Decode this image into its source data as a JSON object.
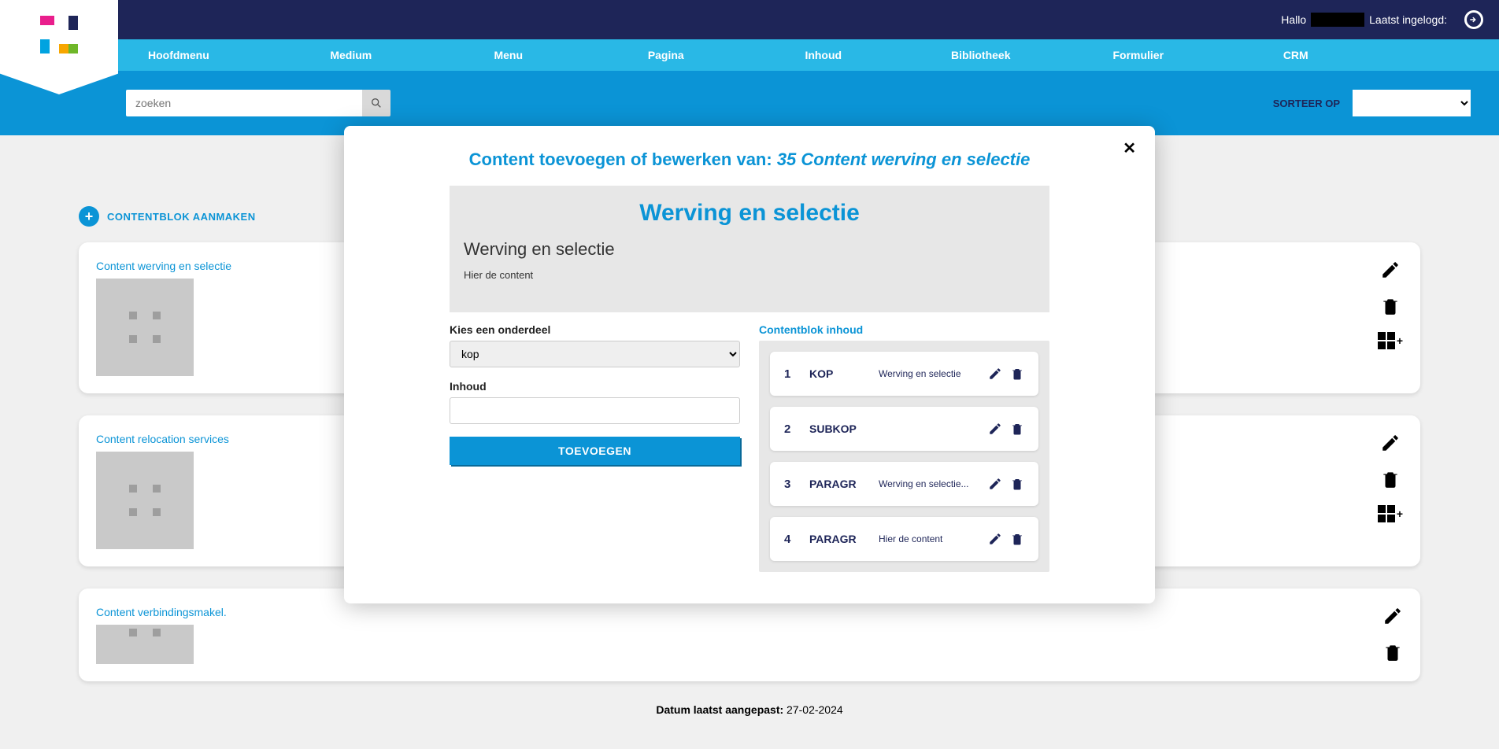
{
  "header": {
    "greeting_prefix": "Hallo",
    "last_login_label": "Laatst ingelogd:"
  },
  "nav": {
    "items": [
      "Hoofdmenu",
      "Medium",
      "Menu",
      "Pagina",
      "Inhoud",
      "Bibliotheek",
      "Formulier",
      "CRM"
    ]
  },
  "search": {
    "placeholder": "zoeken"
  },
  "sort": {
    "label": "SORTEER OP"
  },
  "create_block_label": "CONTENTBLOK AANMAKEN",
  "cards": [
    {
      "title": "Content werving en selectie"
    },
    {
      "title": "Content relocation services"
    },
    {
      "title": "Content verbindingsmakel."
    }
  ],
  "date": {
    "label": "Datum laatst aangepast:",
    "value": "27-02-2024"
  },
  "modal": {
    "title_prefix": "Content toevoegen of bewerken van: ",
    "title_italic": "35 Content werving en selectie",
    "preview": {
      "heading": "Werving en selectie",
      "subheading": "Werving en selectie",
      "content": "Hier de content"
    },
    "left": {
      "select_label": "Kies een onderdeel",
      "select_value": "kop",
      "input_label": "Inhoud",
      "button": "TOEVOEGEN"
    },
    "right": {
      "title": "Contentblok inhoud",
      "items": [
        {
          "num": "1",
          "type": "KOP",
          "text": "Werving en selectie"
        },
        {
          "num": "2",
          "type": "SUBKOP",
          "text": ""
        },
        {
          "num": "3",
          "type": "PARAGR",
          "text": "Werving en selectie..."
        },
        {
          "num": "4",
          "type": "PARAGR",
          "text": "Hier de content"
        }
      ]
    }
  }
}
